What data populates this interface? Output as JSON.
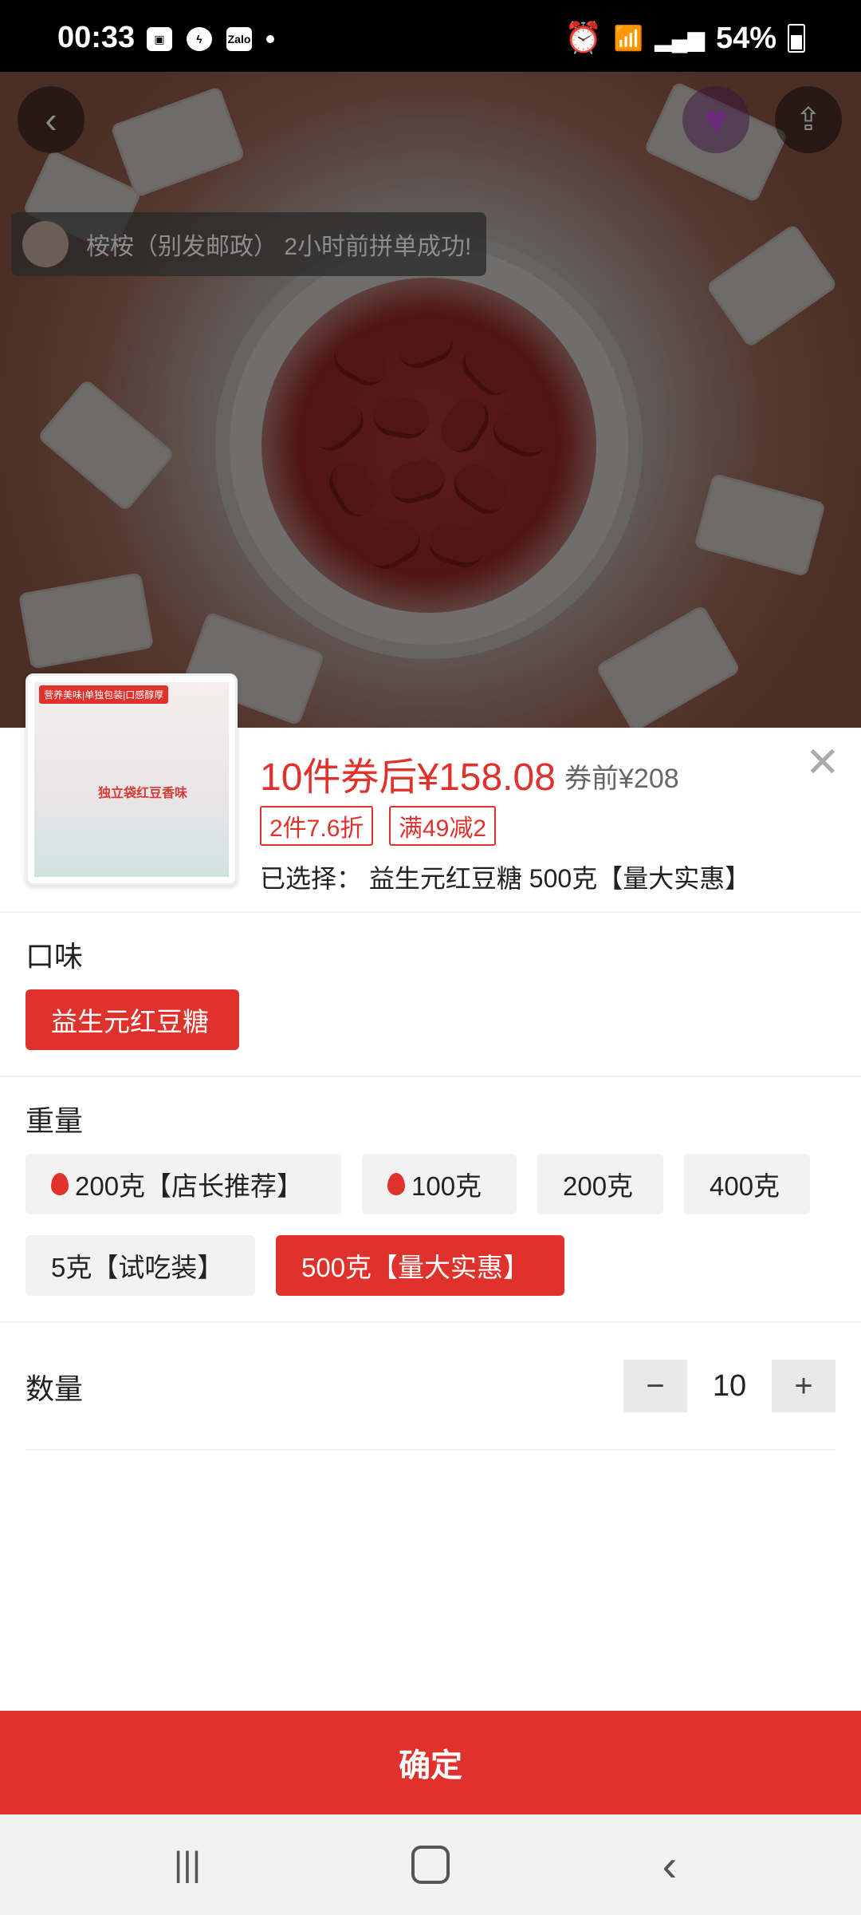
{
  "status_bar": {
    "time": "00:33",
    "battery": "54%",
    "left_icons": [
      "image-icon",
      "messenger-icon",
      "zalo-icon"
    ],
    "zalo_label": "Zalo",
    "right_icons": [
      "alarm-icon",
      "wifi-icon",
      "signal-icon",
      "battery-icon"
    ]
  },
  "hero": {
    "toast_text": "桉桉（别发邮政） 2小时前拼单成功!",
    "back_icon": "chevron-left-icon",
    "share_icon": "share-icon",
    "brand_icon": "heart-logo-icon"
  },
  "product": {
    "thumb_tag": "营养美味|单独包装|口感醇厚",
    "thumb_label": "独立袋红豆香味",
    "price": "10件券后¥158.08",
    "price_before": "券前¥208",
    "promos": [
      "2件7.6折",
      "满49减2"
    ],
    "selected_label": "已选择：",
    "selected_value": "益生元红豆糖 500克【量大实惠】"
  },
  "flavor": {
    "title": "口味",
    "options": [
      {
        "label": "益生元红豆糖",
        "selected": true
      }
    ]
  },
  "weight": {
    "title": "重量",
    "options": [
      {
        "label": "200克【店长推荐】",
        "hot": true,
        "selected": false
      },
      {
        "label": "100克",
        "hot": true,
        "selected": false
      },
      {
        "label": "200克",
        "hot": false,
        "selected": false
      },
      {
        "label": "400克",
        "hot": false,
        "selected": false
      },
      {
        "label": "5克【试吃装】",
        "hot": false,
        "selected": false
      },
      {
        "label": "500克【量大实惠】",
        "hot": false,
        "selected": true
      }
    ]
  },
  "quantity": {
    "title": "数量",
    "value": "10",
    "minus": "−",
    "plus": "+"
  },
  "confirm_label": "确定",
  "colors": {
    "accent": "#e0322c"
  }
}
